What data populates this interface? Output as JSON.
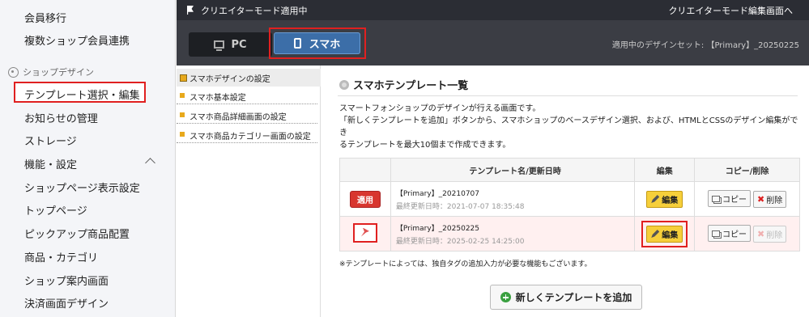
{
  "sidebar": {
    "items_top": [
      "会員移行",
      "複数ショップ会員連携"
    ],
    "section_label": "ショップデザイン",
    "active_item": "テンプレート選択・編集",
    "items": [
      "お知らせの管理",
      "ストレージ",
      "機能・設定",
      "ショップページ表示設定",
      "トップページ",
      "ピックアップ商品配置",
      "商品・カテゴリ",
      "ショップ案内画面",
      "決済画面デザイン"
    ]
  },
  "topbar": {
    "mode_label": "クリエイターモード適用中",
    "edit_link": "クリエイターモード編集画面へ"
  },
  "devicebar": {
    "pc_label": "PC",
    "sp_label": "スマホ",
    "design_set": "適用中のデザインセット: 【Primary】_20250225"
  },
  "submenu": {
    "header": "スマホデザインの設定",
    "items": [
      "スマホ基本設定",
      "スマホ商品詳細画面の設定",
      "スマホ商品カテゴリー画面の設定"
    ]
  },
  "main": {
    "title": "スマホテンプレート一覧",
    "desc_1": "スマートフォンショップのデザインが行える画面です。",
    "desc_2": "「新しくテンプレートを追加」ボタンから、スマホショップのベースデザイン選択、および、HTMLとCSSのデザイン編集ができ",
    "desc_3": "るテンプレートを最大10個まで作成できます。",
    "table_headers": [
      "テンプレート名/更新日時",
      "編集",
      "コピー/削除"
    ],
    "rows": [
      {
        "status": "適用",
        "name": "【Primary】_20210707",
        "date": "最終更新日時：2021-07-07 18:35:48"
      },
      {
        "status": "",
        "name": "【Primary】_20250225",
        "date": "最終更新日時：2025-02-25 14:25:00"
      }
    ],
    "edit_label": "編集",
    "copy_label": "コピー",
    "delete_label": "削除",
    "note": "※テンプレートによっては、独自タグの追加入力が必要な機能もございます。",
    "add_button": "新しくテンプレートを追加"
  }
}
